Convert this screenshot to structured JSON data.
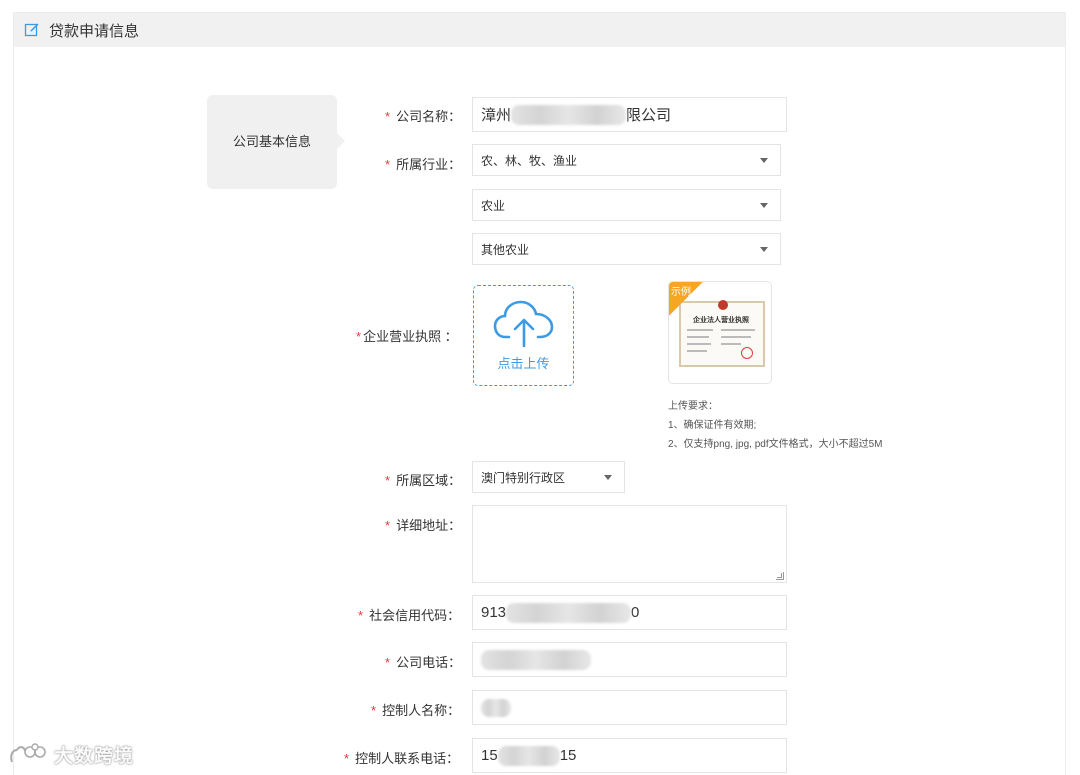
{
  "panel": {
    "title": "贷款申请信息",
    "icon": "edit-icon"
  },
  "section": {
    "label": "公司基本信息"
  },
  "fields": {
    "company_name": {
      "label": "公司名称：",
      "value_prefix": "漳州",
      "value_suffix": "限公司"
    },
    "industry": {
      "label": "所属行业：",
      "level1": "农、林、牧、渔业",
      "level2": "农业",
      "level3": "其他农业"
    },
    "license": {
      "label": "企业营业执照 ：",
      "upload_label": "点击上传",
      "sample_badge": "示例",
      "sample_title": "企业法人营业执照",
      "requirements": [
        "上传要求：",
        "1、确保证件有效期;",
        "2、仅支持png, jpg, pdf文件格式，大小不超过5M"
      ]
    },
    "region": {
      "label": "所属区域：",
      "value": "澳门特别行政区"
    },
    "address": {
      "label": "详细地址：",
      "value": ""
    },
    "credit_code": {
      "label": "社会信用代码：",
      "value_prefix": "913",
      "value_suffix": "0"
    },
    "company_phone": {
      "label": "公司电话：",
      "value": ""
    },
    "controller_name": {
      "label": "控制人名称：",
      "value_prefix": "",
      "value_suffix": ""
    },
    "controller_phone": {
      "label": "控制人联系电话：",
      "value_prefix": "15",
      "value_suffix": "15"
    }
  },
  "watermark": {
    "text": "大数跨境"
  },
  "colors": {
    "accent": "#3d9be5",
    "required": "#e4393c",
    "badge": "#f5a623"
  }
}
